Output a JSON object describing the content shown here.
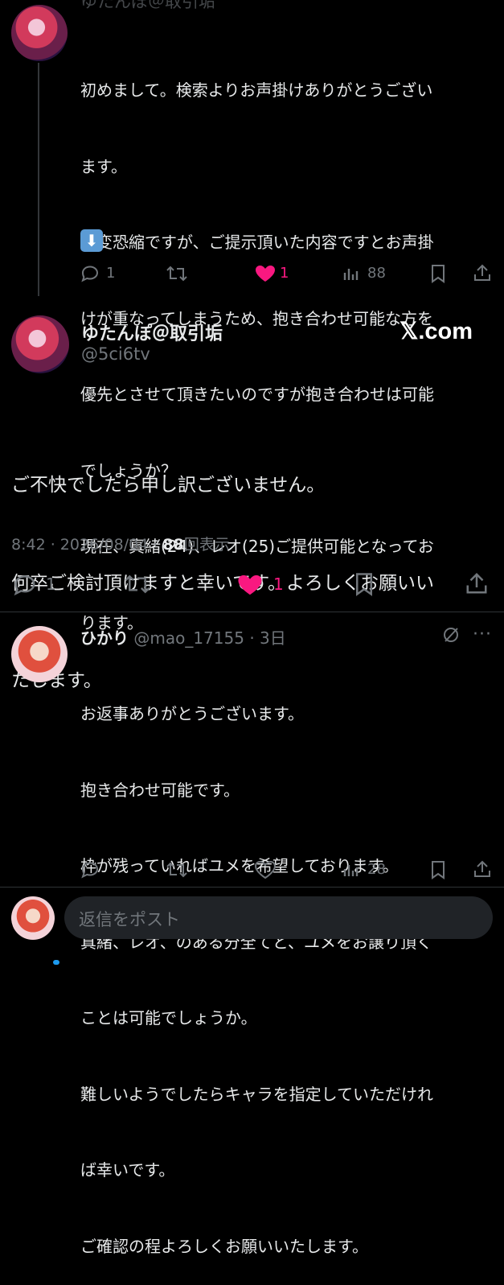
{
  "tweet1": {
    "header_partial": "ゆたんぽ＠取引垢",
    "lines": [
      "初めまして。検索よりお声掛けありがとうござい",
      "ます。",
      "大変恐縮ですが、ご提示頂いた内容ですとお声掛",
      "けが重なってしまうため、抱き合わせ可能な方を",
      "優先とさせて頂きたいのですが抱き合わせは可能",
      "でしょうか？",
      "現在、真緒(24)、レオ(25)ご提供可能となってお",
      "ります。"
    ],
    "emoji": "⬇️",
    "reply_count": "1",
    "like_count": "1",
    "view_count": "88"
  },
  "main_tweet": {
    "display_name": "ゆたんぽ＠取引垢",
    "handle": "@5ci6tv",
    "brand": "𝕏.com",
    "lines": [
      "ご不快でしたら申し訳ございません。",
      "何卒ご検討頂けますと幸いです。よろしくお願いい",
      "たします。"
    ],
    "time": "8:42 · 2026/08/04 · ",
    "views_num": "88",
    "views_label": "回表示",
    "reply_count": "1",
    "like_count": "1"
  },
  "reply_tweet": {
    "display_name": "ひかり",
    "handle_time": "@mao_17155 · 3日",
    "lines": [
      "お返事ありがとうございます。",
      "抱き合わせ可能です。",
      "枠が残っていればユメを希望しております。",
      "真緒、レオ、のある分全てと、ユメをお譲り頂く",
      "ことは可能でしょうか。",
      "難しいようでしたらキャラを指定していただけれ",
      "ば幸いです。",
      "ご確認の程よろしくお願いいたします。"
    ],
    "view_count": "28"
  },
  "composer": {
    "placeholder": "返信をポスト"
  },
  "colors": {
    "like": "#f91880",
    "text": "#e7e9ea",
    "muted": "#71767b"
  }
}
